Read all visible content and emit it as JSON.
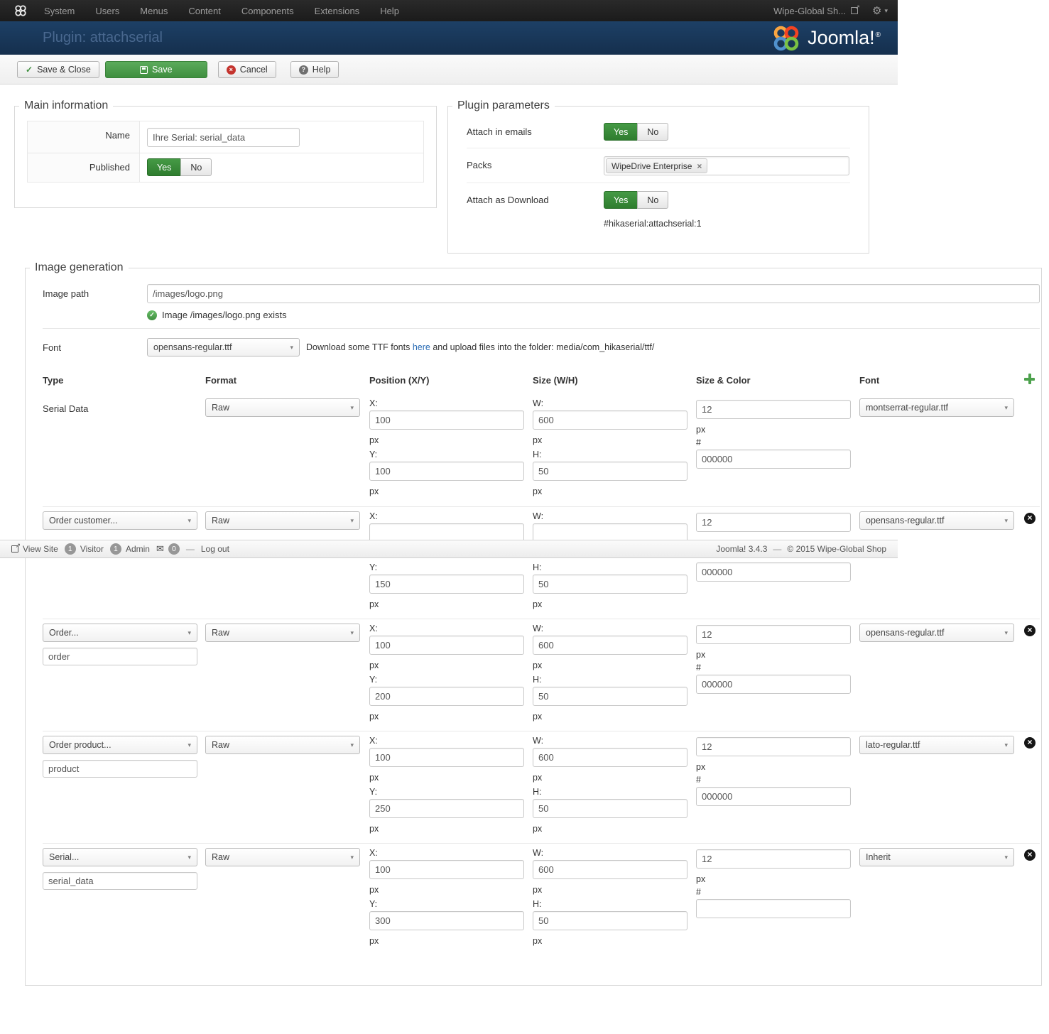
{
  "topbar": {
    "menu_items": [
      "System",
      "Users",
      "Menus",
      "Content",
      "Components",
      "Extensions",
      "Help"
    ],
    "site_name": "Wipe-Global Sh..."
  },
  "header": {
    "page_title": "Plugin: attachserial",
    "brand": "Joomla!",
    "brand_reg": "®"
  },
  "toolbar": {
    "save_close": "Save & Close",
    "save": "Save",
    "cancel": "Cancel",
    "help": "Help"
  },
  "main_info": {
    "legend": "Main information",
    "name_label": "Name",
    "name_value": "Ihre Serial: serial_data",
    "published_label": "Published",
    "yes_label": "Yes",
    "no_label": "No"
  },
  "plugin_params": {
    "legend": "Plugin parameters",
    "attach_emails_label": "Attach in emails",
    "packs_label": "Packs",
    "packs_tag": "WipeDrive Enterprise",
    "attach_download_label": "Attach as Download",
    "plugin_code": "#hikaserial:attachserial:1",
    "yes_label": "Yes",
    "no_label": "No"
  },
  "image_gen": {
    "legend": "Image generation",
    "image_path_label": "Image path",
    "image_path_value": "/images/logo.png",
    "image_exists_text": "Image /images/logo.png exists",
    "font_label": "Font",
    "font_value": "opensans-regular.ttf",
    "font_help_before": "Download some TTF fonts ",
    "font_help_link": "here",
    "font_help_after": " and upload files into the folder: media/com_hikaserial/ttf/",
    "col_type": "Type",
    "col_format": "Format",
    "col_position": "Position (X/Y)",
    "col_size": "Size (W/H)",
    "col_size_color": "Size & Color",
    "col_font": "Font",
    "labels": {
      "x": "X:",
      "y": "Y:",
      "w": "W:",
      "h": "H:",
      "px": "px",
      "hash": "#"
    },
    "rows": [
      {
        "type_text": "Serial Data",
        "format": "Raw",
        "x": "100",
        "y": "100",
        "w": "600",
        "h": "50",
        "size": "12",
        "color": "000000",
        "font": "montserrat-regular.ttf"
      },
      {
        "type_select": "Order customer...",
        "format": "Raw",
        "x": "",
        "y": "150",
        "w": "",
        "h": "50",
        "size": "12",
        "color": "000000",
        "font": "opensans-regular.ttf"
      },
      {
        "type_select": "Order...",
        "type_value": "order",
        "format": "Raw",
        "x": "100",
        "y": "200",
        "w": "600",
        "h": "50",
        "size": "12",
        "color": "000000",
        "font": "opensans-regular.ttf"
      },
      {
        "type_select": "Order product...",
        "type_value": "product",
        "format": "Raw",
        "x": "100",
        "y": "250",
        "w": "600",
        "h": "50",
        "size": "12",
        "color": "000000",
        "font": "lato-regular.ttf"
      },
      {
        "type_select": "Serial...",
        "type_value": "serial_data",
        "format": "Raw",
        "x": "100",
        "y": "300",
        "w": "600",
        "h": "50",
        "size": "12",
        "color": "",
        "font": "Inherit"
      }
    ]
  },
  "footer": {
    "view_site": "View Site",
    "visitor_count": "1",
    "visitor_label": "Visitor",
    "admin_count": "1",
    "admin_label": "Admin",
    "message_count": "0",
    "dash": "—",
    "logout": "Log out",
    "version": "Joomla! 3.4.3",
    "separator": "—",
    "copyright": "© 2015 Wipe-Global Shop"
  },
  "icons": {
    "check": "✓",
    "close": "×",
    "question": "?",
    "gear": "⚙",
    "caret": "▾",
    "envelope": "✉",
    "arrow_ne": "↗"
  },
  "colors": {
    "toggle_active_green": "#3f8f3f",
    "save_button_green": "#4a9c4a",
    "link_blue": "#2a6cb5",
    "header_blue": "#1d4066",
    "joomla_logo": [
      "#f9a541",
      "#f44321",
      "#5091cd",
      "#7ac143"
    ]
  }
}
